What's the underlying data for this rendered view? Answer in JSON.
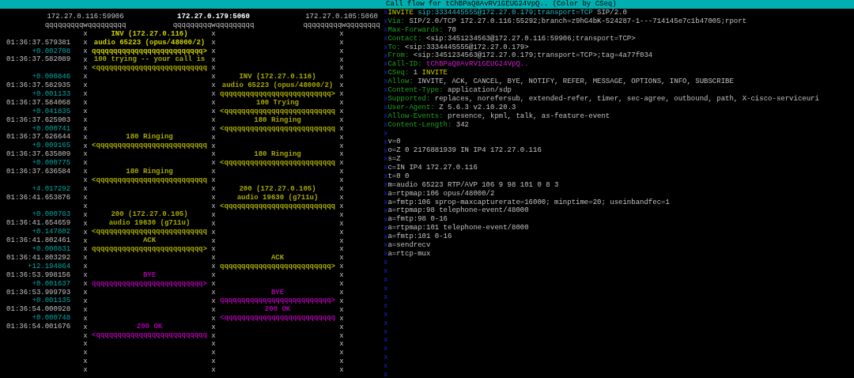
{
  "title_bar": {
    "title": "Call flow for tChBPaQ8AvRV1GEUG24VpQ.. (Color by CSeq)"
  },
  "call_flow": {
    "hosts": [
      {
        "address": "172.27.0.116:59906",
        "line": "qqqqqqqqqwqqqqqqqqq",
        "bold": false
      },
      {
        "address": "172.27.0.179:5060",
        "line": "qqqqqqqqqwqqqqqqqqq",
        "bold": true
      },
      {
        "address": "172.27.0.105:5060",
        "line": "qqqqqqqqqwqqqqqqqq",
        "bold": false
      }
    ],
    "lifelines": [
      "xxxxxxxxxxxxxxxxxxxxxxxxxxxxxxxxxxxxxxxx",
      "xxxxxxxxxxxxxxxxxxxxxxxxxxxxxxxxxxxxxxxx",
      "xxxxxxxxxxxxxxxxxxxxxxxxxxxxxxxxxxxxxxxx"
    ],
    "lines": [
      {
        "left": {
          "text": "INV (172.27.0.116)",
          "color": "#d0d000"
        }
      },
      {
        "time": "01:36:37.579381",
        "left": {
          "text": "audio 65223 (opus/48000/2)",
          "color": "#d0d000"
        }
      },
      {
        "delta": "+0.002708",
        "left": {
          "text": "qqqqqqqqqqqqqqqqqqqqqqqqqq>",
          "color": "#d0d000"
        }
      },
      {
        "time": "01:36:37.582089",
        "left": {
          "text": "100 trying -- your call is",
          "color": "#a8a800"
        }
      },
      {
        "left": {
          "text": "<qqqqqqqqqqqqqqqqqqqqqqqqqq",
          "color": "#a8a800"
        }
      },
      {
        "delta": "+0.000846",
        "right": {
          "text": "INV (172.27.0.116)",
          "color": "#a8a800"
        }
      },
      {
        "time": "01:36:37.582935",
        "right": {
          "text": "audio 65223 (opus/48000/2)",
          "color": "#a8a800"
        }
      },
      {
        "delta": "+0.001133",
        "right": {
          "text": "qqqqqqqqqqqqqqqqqqqqqqqqqq>",
          "color": "#a8a800"
        }
      },
      {
        "time": "01:36:37.584068",
        "right": {
          "text": "100 Trying",
          "color": "#a8a800"
        }
      },
      {
        "delta": "+0.041835",
        "right": {
          "text": "<qqqqqqqqqqqqqqqqqqqqqqqqqq",
          "color": "#a8a800"
        }
      },
      {
        "time": "01:36:37.625903",
        "right": {
          "text": "180 Ringing",
          "color": "#a8a800"
        }
      },
      {
        "delta": "+0.000741",
        "right": {
          "text": "<qqqqqqqqqqqqqqqqqqqqqqqqqq",
          "color": "#a8a800"
        }
      },
      {
        "time": "01:36:37.626644",
        "left": {
          "text": "180 Ringing",
          "color": "#a8a800"
        }
      },
      {
        "delta": "+0.009165",
        "left": {
          "text": "<qqqqqqqqqqqqqqqqqqqqqqqqqq",
          "color": "#a8a800"
        }
      },
      {
        "time": "01:36:37.635809",
        "right": {
          "text": "180 Ringing",
          "color": "#a8a800"
        }
      },
      {
        "delta": "+0.000775",
        "right": {
          "text": "<qqqqqqqqqqqqqqqqqqqqqqqqqq",
          "color": "#a8a800"
        }
      },
      {
        "time": "01:36:37.636584",
        "left": {
          "text": "180 Ringing",
          "color": "#a8a800"
        }
      },
      {
        "left": {
          "text": "<qqqqqqqqqqqqqqqqqqqqqqqqqq",
          "color": "#a8a800"
        }
      },
      {
        "delta": "+4.017292",
        "right": {
          "text": "200 (172.27.0.105)",
          "color": "#a8a800"
        }
      },
      {
        "time": "01:36:41.653876",
        "right": {
          "text": "audio 19630 (g711u)",
          "color": "#a8a800"
        }
      },
      {
        "right": {
          "text": "<qqqqqqqqqqqqqqqqqqqqqqqqqq",
          "color": "#a8a800"
        }
      },
      {
        "delta": "+0.000783",
        "left": {
          "text": "200 (172.27.0.105)",
          "color": "#a8a800"
        }
      },
      {
        "time": "01:36:41.654659",
        "left": {
          "text": "audio 19630 (g711u)",
          "color": "#a8a800"
        }
      },
      {
        "delta": "+0.147802",
        "left": {
          "text": "<qqqqqqqqqqqqqqqqqqqqqqqqqq",
          "color": "#a8a800"
        }
      },
      {
        "time": "01:36:41.802461",
        "left": {
          "text": "ACK",
          "color": "#a8a800"
        }
      },
      {
        "delta": "+0.000831",
        "left": {
          "text": "qqqqqqqqqqqqqqqqqqqqqqqqqq>",
          "color": "#a8a800"
        }
      },
      {
        "time": "01:36:41.803292",
        "right": {
          "text": "ACK",
          "color": "#a8a800"
        }
      },
      {
        "delta": "+12.194864",
        "right": {
          "text": "qqqqqqqqqqqqqqqqqqqqqqqqqq>",
          "color": "#a8a800"
        }
      },
      {
        "time": "01:36:53.998156",
        "left": {
          "text": "BYE",
          "color": "#a800a8"
        }
      },
      {
        "delta": "+0.001637",
        "left": {
          "text": "qqqqqqqqqqqqqqqqqqqqqqqqqq>",
          "color": "#a800a8"
        }
      },
      {
        "time": "01:36:53.999793",
        "right": {
          "text": "BYE",
          "color": "#a800a8"
        }
      },
      {
        "delta": "+0.001135",
        "right": {
          "text": "qqqqqqqqqqqqqqqqqqqqqqqqqq>",
          "color": "#a800a8"
        }
      },
      {
        "time": "01:36:54.000928",
        "right": {
          "text": "200 OK",
          "color": "#a800a8"
        }
      },
      {
        "delta": "+0.000748",
        "right": {
          "text": "<qqqqqqqqqqqqqqqqqqqqqqqqqq",
          "color": "#a800a8"
        }
      },
      {
        "time": "01:36:54.001676",
        "left": {
          "text": "200 OK",
          "color": "#a800a8"
        }
      },
      {
        "left": {
          "text": "<qqqqqqqqqqqqqqqqqqqqqqqqqq",
          "color": "#a800a8"
        }
      }
    ]
  },
  "message_detail": {
    "rail": "xxxxxxxxxxxxxxxxxxxxxxxxxxxxxxxxxxxxxxxxxxx",
    "lines": [
      {
        "kind": "request",
        "method": "INVITE",
        "uri": "sip:3334445555@172.27.0.179;transport=TCP",
        "version": "SIP/2.0"
      },
      {
        "kind": "header",
        "name": "Via:",
        "value": "SIP/2.0/TCP 172.27.0.116:55292;branch=z9hG4bK-524287-1---714145e7c1b47005;rport"
      },
      {
        "kind": "header",
        "name": "Max-Forwards:",
        "value": "70"
      },
      {
        "kind": "header",
        "name": "Contact:",
        "value": "<sip:3451234563@172.27.0.116:59906;transport=TCP>"
      },
      {
        "kind": "header",
        "name": "To:",
        "value": "<sip:3334445555@172.27.0.179>"
      },
      {
        "kind": "header",
        "name": "From:",
        "value": "<sip:3451234563@172.27.0.179;transport=TCP>;tag=4a77f034"
      },
      {
        "kind": "callid",
        "name": "Call-ID:",
        "value": "tChBPaQ8AvRV1GEUG24VpQ.."
      },
      {
        "kind": "cseq",
        "name": "CSeq:",
        "value": "1",
        "method": "INVITE"
      },
      {
        "kind": "header",
        "name": "Allow:",
        "value": "INVITE, ACK, CANCEL, BYE, NOTIFY, REFER, MESSAGE, OPTIONS, INFO, SUBSCRIBE"
      },
      {
        "kind": "header",
        "name": "Content-Type:",
        "value": "application/sdp"
      },
      {
        "kind": "header",
        "name": "Supported:",
        "value": "replaces, norefersub, extended-refer, timer, sec-agree, outbound, path, X-cisco-serviceuri"
      },
      {
        "kind": "header",
        "name": "User-Agent:",
        "value": "Z 5.6.3 v2.10.20.3"
      },
      {
        "kind": "header",
        "name": "Allow-Events:",
        "value": "presence, kpml, talk, as-feature-event"
      },
      {
        "kind": "header",
        "name": "Content-Length:",
        "value": "342"
      },
      {
        "kind": "blank"
      },
      {
        "kind": "body",
        "text": "v=0"
      },
      {
        "kind": "body",
        "text": "o=Z 0 2176881939 IN IP4 172.27.0.116"
      },
      {
        "kind": "body",
        "text": "s=Z"
      },
      {
        "kind": "body",
        "text": "c=IN IP4 172.27.0.116"
      },
      {
        "kind": "body",
        "text": "t=0 0"
      },
      {
        "kind": "body",
        "text": "m=audio 65223 RTP/AVP 106 9 98 101 0 8 3"
      },
      {
        "kind": "body",
        "text": "a=rtpmap:106 opus/48000/2"
      },
      {
        "kind": "body",
        "text": "a=fmtp:106 sprop-maxcapturerate=16000; minptime=20; useinbandfec=1"
      },
      {
        "kind": "body",
        "text": "a=rtpmap:98 telephone-event/48000"
      },
      {
        "kind": "body",
        "text": "a=fmtp:98 0-16"
      },
      {
        "kind": "body",
        "text": "a=rtpmap:101 telephone-event/8000"
      },
      {
        "kind": "body",
        "text": "a=fmtp:101 0-16"
      },
      {
        "kind": "body",
        "text": "a=sendrecv"
      },
      {
        "kind": "body",
        "text": "a=rtcp-mux"
      }
    ]
  }
}
